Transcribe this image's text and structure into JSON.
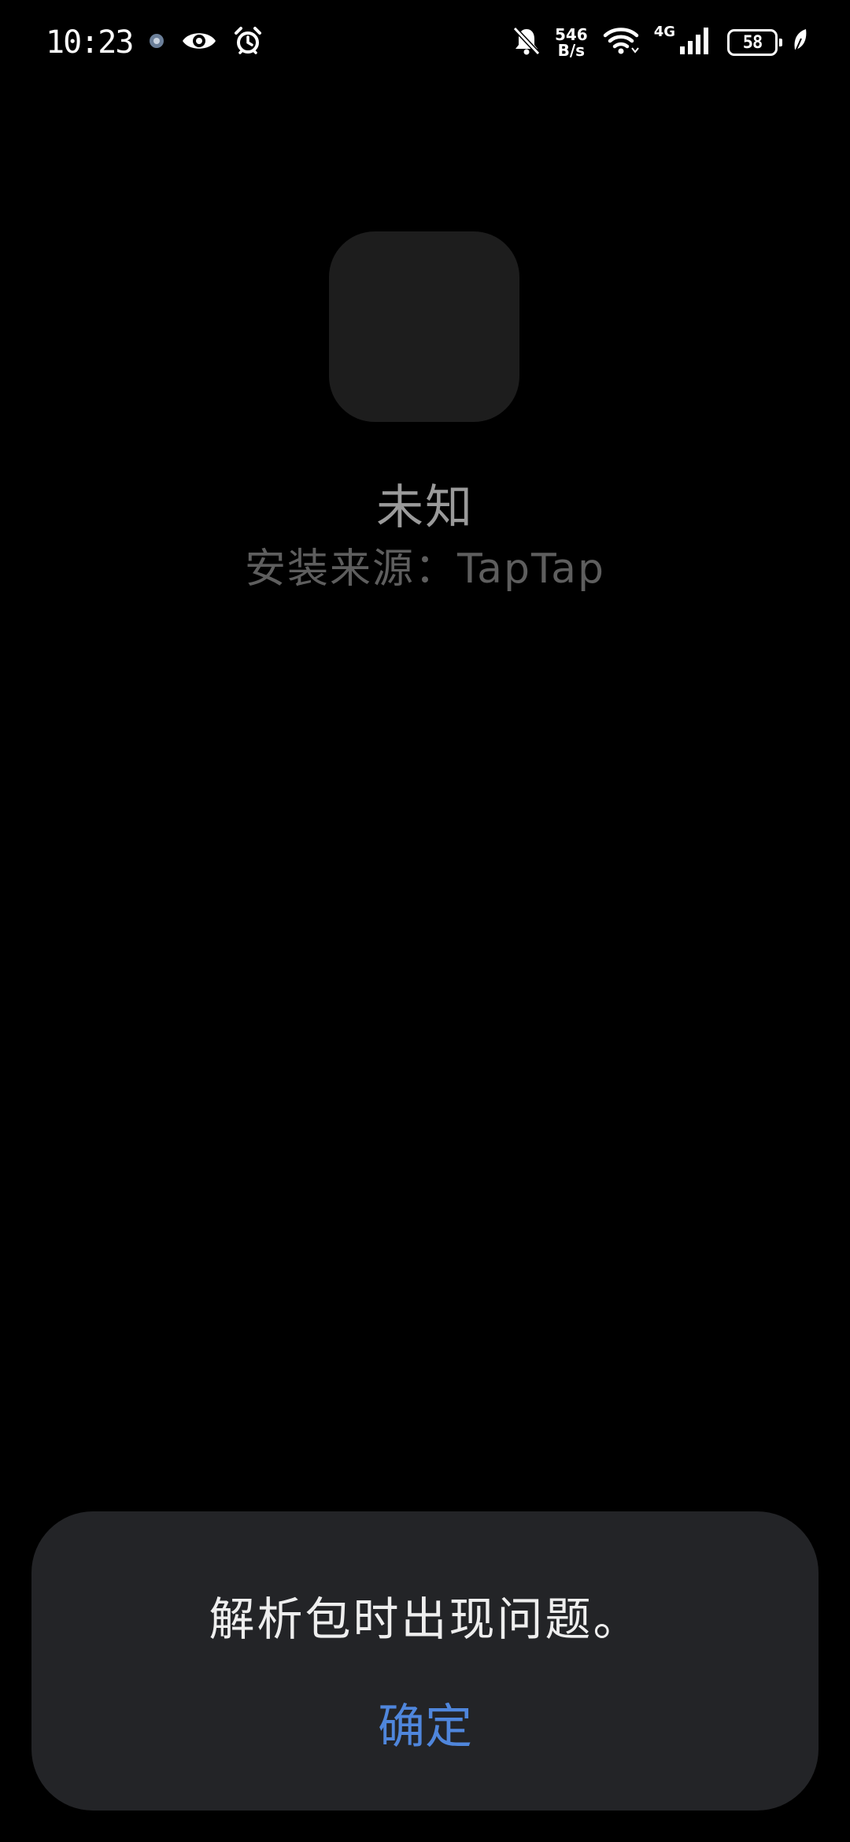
{
  "status_bar": {
    "time": "10:23",
    "net_speed_value": "546",
    "net_speed_unit": "B/s",
    "network_type": "4G",
    "battery_level": "58",
    "icons": [
      "notification-app-icon",
      "eye-icon",
      "alarm-icon",
      "bell-off-icon",
      "wifi-icon",
      "cellular-signal-icon",
      "battery-icon",
      "leaf-icon"
    ]
  },
  "app": {
    "name": "未知",
    "install_source": "安装来源：TapTap"
  },
  "dialog": {
    "message": "解析包时出现问题。",
    "confirm_label": "确定",
    "confirm_color": "#4f86dc"
  },
  "colors": {
    "background": "#000000",
    "dialog_background": "#232427",
    "icon_placeholder": "#1d1d1d"
  }
}
